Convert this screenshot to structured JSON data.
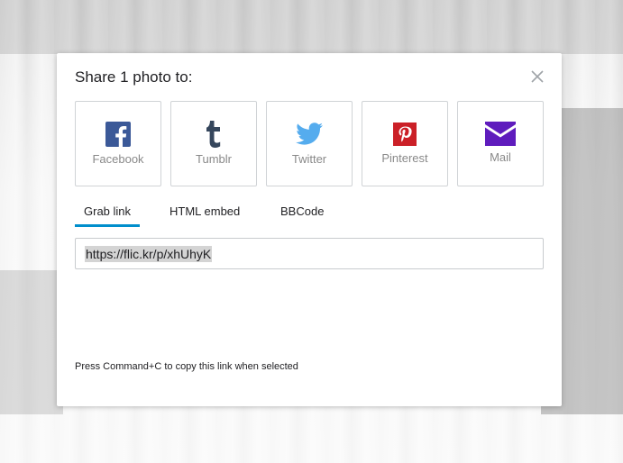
{
  "dialog": {
    "title": "Share 1 photo to:"
  },
  "services": [
    {
      "label": "Facebook",
      "icon": "facebook-icon",
      "color": "#3b5998"
    },
    {
      "label": "Tumblr",
      "icon": "tumblr-icon",
      "color": "#35465c"
    },
    {
      "label": "Twitter",
      "icon": "twitter-icon",
      "color": "#55acee"
    },
    {
      "label": "Pinterest",
      "icon": "pinterest-icon",
      "color": "#cb2027"
    },
    {
      "label": "Mail",
      "icon": "mail-icon",
      "color": "#5f1cbd"
    }
  ],
  "tabs": [
    {
      "label": "Grab link",
      "active": true
    },
    {
      "label": "HTML embed",
      "active": false
    },
    {
      "label": "BBCode",
      "active": false
    }
  ],
  "link": {
    "value": "https://flic.kr/p/xhUhyK"
  },
  "hint": "Press Command+C to copy this link when selected",
  "colors": {
    "accent": "#008ecc",
    "border": "#d0d3d6",
    "text": "#212124",
    "muted": "#898989"
  }
}
